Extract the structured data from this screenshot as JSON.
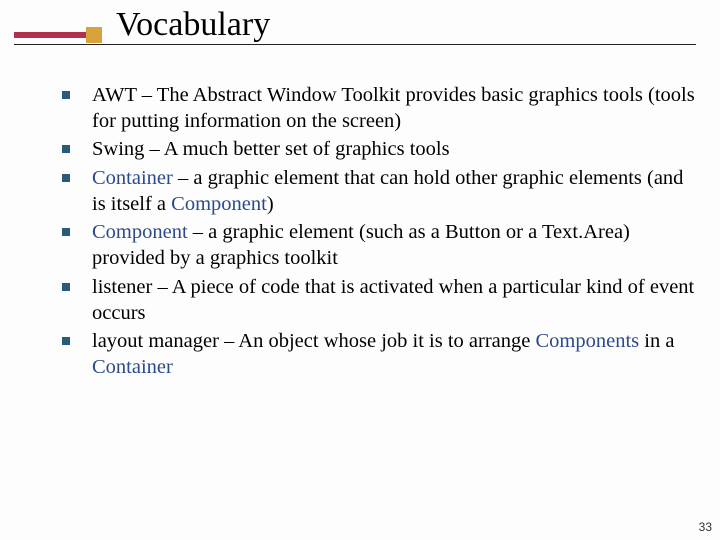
{
  "title": "Vocabulary",
  "items": [
    {
      "term": "AWT",
      "term_class": "term",
      "desc": " – The Abstract Window Toolkit provides basic graphics tools (tools for putting information on the screen)"
    },
    {
      "term": "Swing",
      "term_class": "term",
      "desc": " – A much better set of graphics tools"
    },
    {
      "term": "Container",
      "term_class": "code",
      "desc_pre": " – a graphic element that can hold other graphic elements (and is itself a ",
      "inline_code": "Component",
      "desc_post": ")"
    },
    {
      "term": "Component",
      "term_class": "code",
      "desc": " – a graphic element (such as a Button or a Text.Area) provided by a graphics toolkit"
    },
    {
      "term": "listener",
      "term_class": "term",
      "desc": " – A piece of code that is activated when a particular kind of event occurs"
    },
    {
      "term": "layout manager",
      "term_class": "term",
      "desc_pre": " – An object whose job it is to arrange ",
      "inline_code": "Components",
      "mid": " in a ",
      "inline_code2": "Container",
      "desc_post": ""
    }
  ],
  "page_number": "33"
}
